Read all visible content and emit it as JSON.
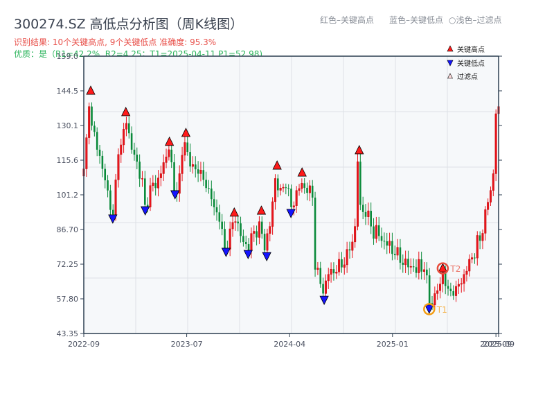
{
  "header": {
    "title": "300274.SZ 高低点分析图（周K线图）",
    "result_line": "识别结果: 10个关键高点, 9个关键低点   准确度: 95.3%",
    "quality_line": "优质：是（R1=42.2%, R2=4.25；T1=2025-04-11 P1=52.98)",
    "legend_red": "红色–关键高点",
    "legend_blue": "蓝色–关键低点",
    "legend_light": "○浅色–过滤点"
  },
  "colors": {
    "up": "#e8141c",
    "down": "#0a8a3a",
    "high_marker": "#ff1a1a",
    "low_marker": "#1414ff",
    "t1": "#f39c12",
    "t2": "#e74c3c",
    "plot_bg": "#f6f8fa"
  },
  "chart_data": {
    "type": "candlestick",
    "title": "300274.SZ 高低点分析图（周K线图）",
    "ylim": [
      43.35,
      159.0
    ],
    "yticks": [
      "159.0",
      "144.5",
      "130.1",
      "115.6",
      "101.2",
      "86.70",
      "72.25",
      "57.80",
      "43.35"
    ],
    "xticks": [
      {
        "week": 0,
        "label": "2022-09"
      },
      {
        "week": 38.7,
        "label": "2023-07"
      },
      {
        "week": 77.4,
        "label": "2024-04"
      },
      {
        "week": 116.1,
        "label": "2025-01"
      },
      {
        "week": 155,
        "label": "2025-09"
      },
      {
        "week": 156,
        "label": "2025-09"
      }
    ],
    "weeks": 157,
    "close_keypoints": [
      [
        0,
        112
      ],
      [
        1,
        125
      ],
      [
        2,
        138
      ],
      [
        3,
        130
      ],
      [
        5,
        120
      ],
      [
        7,
        112
      ],
      [
        9,
        103
      ],
      [
        11,
        93
      ],
      [
        13,
        118
      ],
      [
        14,
        122
      ],
      [
        16,
        131
      ],
      [
        18,
        120
      ],
      [
        20,
        115
      ],
      [
        22,
        108
      ],
      [
        23,
        97
      ],
      [
        25,
        105
      ],
      [
        27,
        104
      ],
      [
        29,
        110
      ],
      [
        31,
        117
      ],
      [
        32,
        120
      ],
      [
        34,
        103
      ],
      [
        36,
        110
      ],
      [
        38,
        123
      ],
      [
        40,
        113
      ],
      [
        43,
        110
      ],
      [
        46,
        104
      ],
      [
        49,
        96
      ],
      [
        51,
        90
      ],
      [
        53,
        79
      ],
      [
        55,
        87
      ],
      [
        57,
        90
      ],
      [
        59,
        84
      ],
      [
        62,
        78
      ],
      [
        64,
        86
      ],
      [
        66,
        90
      ],
      [
        68,
        78
      ],
      [
        70,
        88
      ],
      [
        72,
        108
      ],
      [
        74,
        104
      ],
      [
        76,
        104
      ],
      [
        78,
        96
      ],
      [
        80,
        103
      ],
      [
        82,
        106
      ],
      [
        84,
        102
      ],
      [
        86,
        100
      ],
      [
        87,
        70
      ],
      [
        89,
        64
      ],
      [
        90,
        60
      ],
      [
        92,
        68
      ],
      [
        95,
        69
      ],
      [
        98,
        72
      ],
      [
        100,
        78
      ],
      [
        102,
        88
      ],
      [
        103,
        115
      ],
      [
        104,
        97
      ],
      [
        106,
        92
      ],
      [
        108,
        88
      ],
      [
        111,
        84
      ],
      [
        114,
        80
      ],
      [
        117,
        76
      ],
      [
        120,
        72
      ],
      [
        124,
        71
      ],
      [
        128,
        70
      ],
      [
        130,
        56
      ],
      [
        132,
        60
      ],
      [
        134,
        64
      ],
      [
        135,
        69
      ],
      [
        137,
        62
      ],
      [
        140,
        63
      ],
      [
        143,
        68
      ],
      [
        146,
        75
      ],
      [
        149,
        82
      ],
      [
        151,
        95
      ],
      [
        153,
        103
      ],
      [
        154,
        110
      ],
      [
        155,
        135
      ],
      [
        156,
        138
      ]
    ],
    "key_highs": [
      [
        2.6,
        144.5
      ],
      [
        15.8,
        135.6
      ],
      [
        32.2,
        123.2
      ],
      [
        38.4,
        126.9
      ],
      [
        56.6,
        93.7
      ],
      [
        66.8,
        94.5
      ],
      [
        72.7,
        113.3
      ],
      [
        82.1,
        110.4
      ],
      [
        103.6,
        119.7
      ],
      [
        135,
        70.5
      ]
    ],
    "key_lows": [
      [
        10.9,
        91.1
      ],
      [
        23.1,
        94.5
      ],
      [
        34.3,
        101.2
      ],
      [
        53.5,
        77.2
      ],
      [
        61.8,
        76.3
      ],
      [
        68.8,
        75.4
      ],
      [
        77.9,
        93.4
      ],
      [
        90.4,
        57.2
      ],
      [
        129.9,
        53.5
      ]
    ],
    "annotations": [
      {
        "label": "T1",
        "week": 129.9,
        "price": 53.5
      },
      {
        "label": "T2",
        "week": 135,
        "price": 70.5
      }
    ],
    "legend": [
      "关键高点",
      "关键低点",
      "过滤点"
    ],
    "legend_position": "top-right"
  }
}
